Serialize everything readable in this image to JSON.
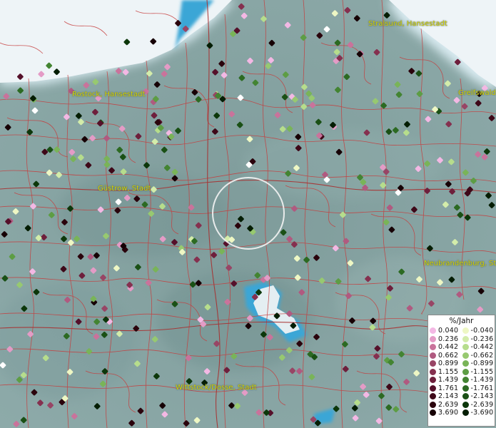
{
  "map": {
    "cities": [
      {
        "id": "stralsund",
        "label": "Stralsund, Hansestadt"
      },
      {
        "id": "rostock",
        "label": "Rostock, Hansestadt"
      },
      {
        "id": "greifswald",
        "label": "Greifswald"
      },
      {
        "id": "guestrow",
        "label": "Güstrow, Stadt"
      },
      {
        "id": "neubrandenburg",
        "label": "Neubrandenburg, Sta"
      },
      {
        "id": "wittstock",
        "label": "Wittstock/Dosse, Stadt"
      }
    ]
  },
  "legend": {
    "title": "%/Jahr",
    "positive": [
      {
        "label": "0.040",
        "color": "#f3b8e4"
      },
      {
        "label": "0.236",
        "color": "#e49bc6"
      },
      {
        "label": "0.442",
        "color": "#c9739b"
      },
      {
        "label": "0.662",
        "color": "#b05a80"
      },
      {
        "label": "0.899",
        "color": "#984565"
      },
      {
        "label": "1.155",
        "color": "#85304f"
      },
      {
        "label": "1.439",
        "color": "#6e1f3c"
      },
      {
        "label": "1.761",
        "color": "#55102a"
      },
      {
        "label": "2.143",
        "color": "#3e0818"
      },
      {
        "label": "2.639",
        "color": "#2a030c"
      },
      {
        "label": "3.690",
        "color": "#160005"
      }
    ],
    "negative": [
      {
        "label": "-0.040",
        "color": "#eef7c4"
      },
      {
        "label": "-0.236",
        "color": "#d3ecaa"
      },
      {
        "label": "-0.442",
        "color": "#b6dd8c"
      },
      {
        "label": "-0.662",
        "color": "#97c970"
      },
      {
        "label": "-0.899",
        "color": "#79b458"
      },
      {
        "label": "-1.155",
        "color": "#5d9d44"
      },
      {
        "label": "-1.439",
        "color": "#438432"
      },
      {
        "label": "-1.761",
        "color": "#2c6a22"
      },
      {
        "label": "-2.143",
        "color": "#1a5015"
      },
      {
        "label": "-2.639",
        "color": "#0c370a"
      },
      {
        "label": "-3.690",
        "color": "#041d03"
      }
    ]
  }
}
